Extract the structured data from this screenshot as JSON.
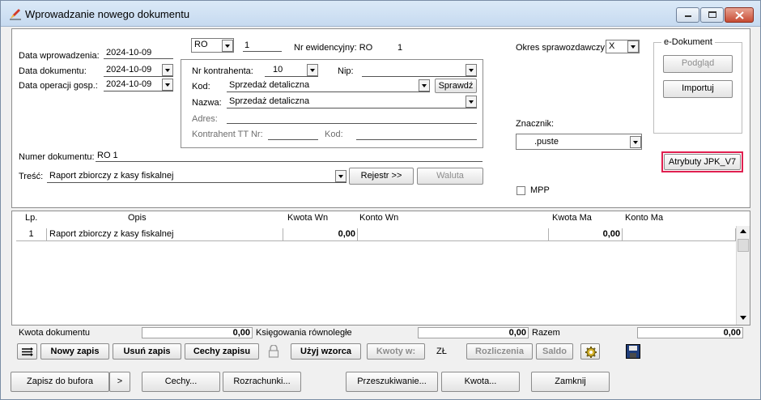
{
  "window": {
    "title": "Wprowadzanie nowego dokumentu"
  },
  "header": {
    "data_wprowadzenia": {
      "label": "Data wprowadzenia:",
      "value": "2024-10-09"
    },
    "data_dokumentu": {
      "label": "Data dokumentu:",
      "value": "2024-10-09"
    },
    "data_operacji": {
      "label": "Data operacji gosp.:",
      "value": "2024-10-09"
    },
    "rejestr": {
      "value": "RO",
      "number": "1"
    },
    "nr_ewidencyjny": {
      "label": "Nr ewidencyjny: RO",
      "value": "1"
    },
    "okres": {
      "label": "Okres sprawozdawczy:",
      "value": "X"
    }
  },
  "kontrahent": {
    "nr_label": "Nr kontrahenta:",
    "nr_value": "10",
    "nip_label": "Nip:",
    "nip_value": "",
    "kod_label": "Kod:",
    "kod_value": "Sprzedaż detaliczna",
    "sprawdz_label": "Sprawdź",
    "nazwa_label": "Nazwa:",
    "nazwa_value": "Sprzedaż detaliczna",
    "adres_label": "Adres:",
    "adres_value": "",
    "tt_label": "Kontrahent TT Nr:",
    "tt_value": "",
    "kod2_label": "Kod:",
    "kod2_value": ""
  },
  "edokument": {
    "title": "e-Dokument",
    "podglad": "Podgląd",
    "importuj": "Importuj"
  },
  "znacznik": {
    "label": "Znacznik:",
    "value": ".puste"
  },
  "atrybuty_label": "Atrybuty JPK_V7",
  "mpp_label": "MPP",
  "numer": {
    "label": "Numer dokumentu:",
    "value": "RO 1"
  },
  "tresc": {
    "label": "Treść:",
    "value": "Raport zbiorczy z kasy fiskalnej",
    "rejestr_btn": "Rejestr >>",
    "waluta_btn": "Waluta"
  },
  "grid": {
    "headers": {
      "lp": "Lp.",
      "opis": "Opis",
      "kwota_wn": "Kwota  Wn",
      "konto_wn": "Konto  Wn",
      "kwota_ma": "Kwota  Ma",
      "konto_ma": "Konto  Ma"
    },
    "rows": [
      {
        "lp": "1",
        "opis": "Raport zbiorczy z kasy fiskalnej",
        "kwota_wn": "0,00",
        "konto_wn": "",
        "kwota_ma": "0,00",
        "konto_ma": ""
      }
    ]
  },
  "summary": {
    "kwota_dokumentu_label": "Kwota dokumentu",
    "kwota_dokumentu": "0,00",
    "ksiegowania_label": "Księgowania równoległe",
    "ksiegowania": "0,00",
    "razem_label": "Razem",
    "razem": "0,00"
  },
  "toolbar": {
    "nowy_zapis": "Nowy zapis",
    "usun_zapis": "Usuń zapis",
    "cechy_zapisu": "Cechy zapisu",
    "uzyj_wzorca": "Użyj wzorca",
    "kwoty_w": "Kwoty w:",
    "currency": "ZŁ",
    "rozliczenia": "Rozliczenia",
    "saldo": "Saldo"
  },
  "bottom": {
    "zapisz": "Zapisz do bufora",
    "more": ">",
    "cechy": "Cechy...",
    "rozrachunki": "Rozrachunki...",
    "przeszukiwanie": "Przeszukiwanie...",
    "kwota": "Kwota...",
    "zamknij": "Zamknij"
  },
  "icons": {
    "title": "pen-icon",
    "list": "list-arrows-icon",
    "lock": "padlock-icon",
    "gear": "gear-icon",
    "save": "floppy-disk-icon"
  },
  "colors": {
    "highlight": "#e02050",
    "titlebar": "#c6daf0"
  }
}
